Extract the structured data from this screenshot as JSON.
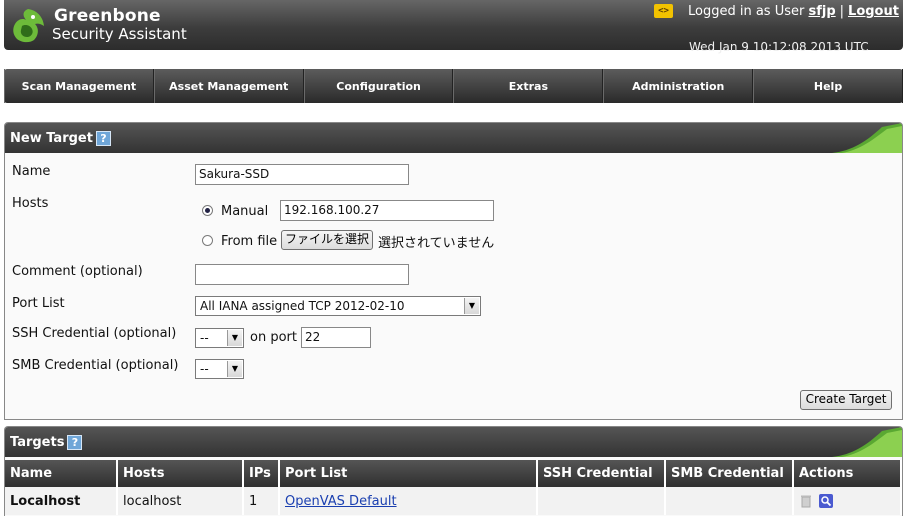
{
  "header": {
    "brand_line1": "Greenbone",
    "brand_line2": "Security Assistant",
    "code_badge": "<>",
    "logged_in_prefix": "Logged in as User",
    "username": "sfjp",
    "separator": "|",
    "logout": "Logout",
    "datetime": "Wed Jan 9 10:12:08 2013 UTC"
  },
  "nav": {
    "items": [
      "Scan Management",
      "Asset Management",
      "Configuration",
      "Extras",
      "Administration",
      "Help"
    ]
  },
  "new_target": {
    "title": "New Target",
    "help_glyph": "?",
    "name_label": "Name",
    "name_value": "Sakura-SSD",
    "hosts_label": "Hosts",
    "manual_label": "Manual",
    "manual_value": "192.168.100.27",
    "from_file_label": "From file",
    "file_button": "ファイルを選択",
    "file_status": "選択されていません",
    "comment_label": "Comment (optional)",
    "comment_value": "",
    "port_list_label": "Port List",
    "port_list_value": "All IANA assigned TCP 2012-02-10",
    "ssh_label": "SSH Credential (optional)",
    "ssh_value": "--",
    "on_port_label": "on port",
    "port_value": "22",
    "smb_label": "SMB Credential (optional)",
    "smb_value": "--",
    "create_button": "Create Target"
  },
  "targets": {
    "title": "Targets",
    "help_glyph": "?",
    "columns": [
      "Name",
      "Hosts",
      "IPs",
      "Port List",
      "SSH Credential",
      "SMB Credential",
      "Actions"
    ],
    "rows": [
      {
        "name": "Localhost",
        "hosts": "localhost",
        "ips": "1",
        "port_list": "OpenVAS Default",
        "ssh": "",
        "smb": ""
      }
    ]
  },
  "colors": {
    "accent_green": "#5aa832",
    "header_dark": "#333333",
    "link_blue": "#1a3fb0"
  }
}
